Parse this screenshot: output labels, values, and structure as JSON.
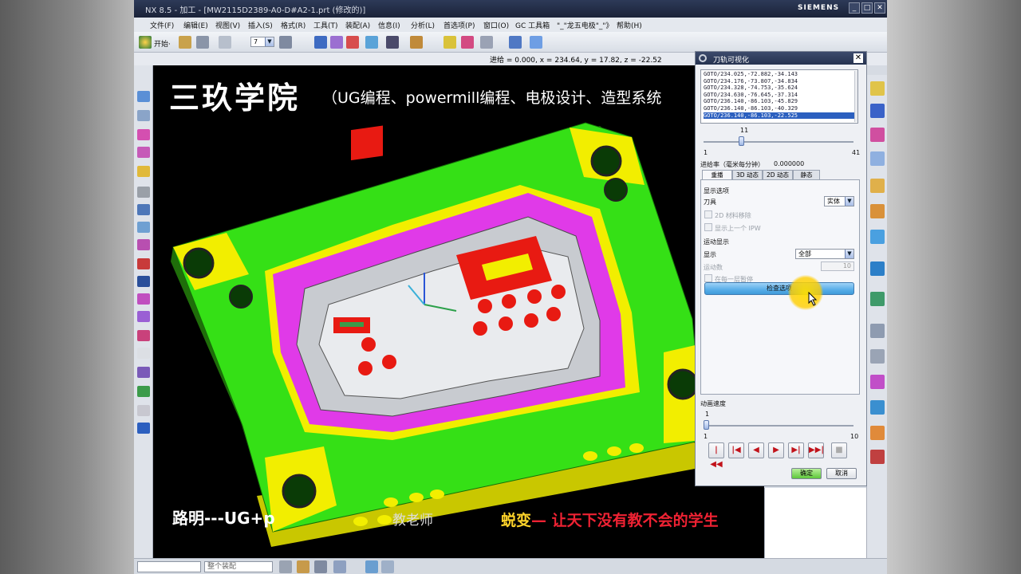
{
  "window": {
    "title": "NX 8.5 - 加工 - [MW2115D2389-A0-D#A2-1.prt  (修改的)]",
    "brand": "SIEMENS",
    "controls": [
      "_",
      "□",
      "✕"
    ]
  },
  "menu": [
    "文件(F)",
    "编辑(E)",
    "视图(V)",
    "插入(S)",
    "格式(R)",
    "工具(T)",
    "装配(A)",
    "信息(I)",
    "分析(L)",
    "首选项(P)",
    "窗口(O)",
    "GC 工具箱",
    "\"_\"龙五电极\"_\"》",
    "帮助(H)"
  ],
  "toolbar": {
    "start_label": "开始·",
    "layer_value": "7"
  },
  "coords": "进给 = 0.000, x = 234.64, y = 17.82, z = -22.52",
  "overlay": {
    "title": "三玖学院",
    "subtitle": "（UG编程、powermill编程、电极设计、造型系统",
    "footer_left": "路明---UG+p",
    "footer_mid": "教老师",
    "footer_right_prefix": "蜕变",
    "footer_right": "— 让天下没有教不会的学生"
  },
  "dialog": {
    "title": "刀轨可视化",
    "goto_lines": [
      "GOTO/234.025,-72.882,-34.143",
      "GOTO/234.176,-73.807,-34.834",
      "GOTO/234.328,-74.753,-35.624",
      "GOTO/234.630,-76.645,-37.314",
      "GOTO/236.140,-86.103,-45.829",
      "GOTO/236.140,-86.103,-40.329",
      "GOTO/236.140,-86.103,-22.525"
    ],
    "selected_line_index": 6,
    "slider1": {
      "value": "11",
      "min": "1",
      "max": "41",
      "fraction": 0.25
    },
    "feed_label": "进给率（毫米每分钟）",
    "feed_value": "0.000000",
    "tabs": [
      "重播",
      "3D 动态",
      "2D 动态",
      "静态"
    ],
    "active_tab": 0,
    "display_options_label": "显示选项",
    "tool_label": "刀具",
    "tool_value": "实体",
    "cb_2d_material": "2D 材料移除",
    "cb_show_prev_ipw": "显示上一个 IPW",
    "motion_display_label": "运动显示",
    "display_label": "显示",
    "display_value": "全部",
    "motion_count_label": "运动数",
    "motion_count_value": "10",
    "pause_each_layer": "在每一层暂停",
    "check_options_button": "检查选项",
    "anim_speed_label": "动画速度",
    "slider2": {
      "value": "1",
      "min": "1",
      "max": "10",
      "fraction": 0.0
    },
    "play_buttons": [
      "|◀◀",
      "|◀",
      "◀",
      "▶",
      "▶|",
      "▶▶|",
      "■"
    ],
    "ok_label": "确定",
    "cancel_label": "取消"
  },
  "statusbar": {
    "filter_value": "",
    "selector_value": "整个装配"
  },
  "colors": {
    "plate_green": "#35e016",
    "plate_yellow": "#f2ee00",
    "magenta": "#e03ae8",
    "red": "#e81a12",
    "accent_blue": "#58aee8"
  }
}
